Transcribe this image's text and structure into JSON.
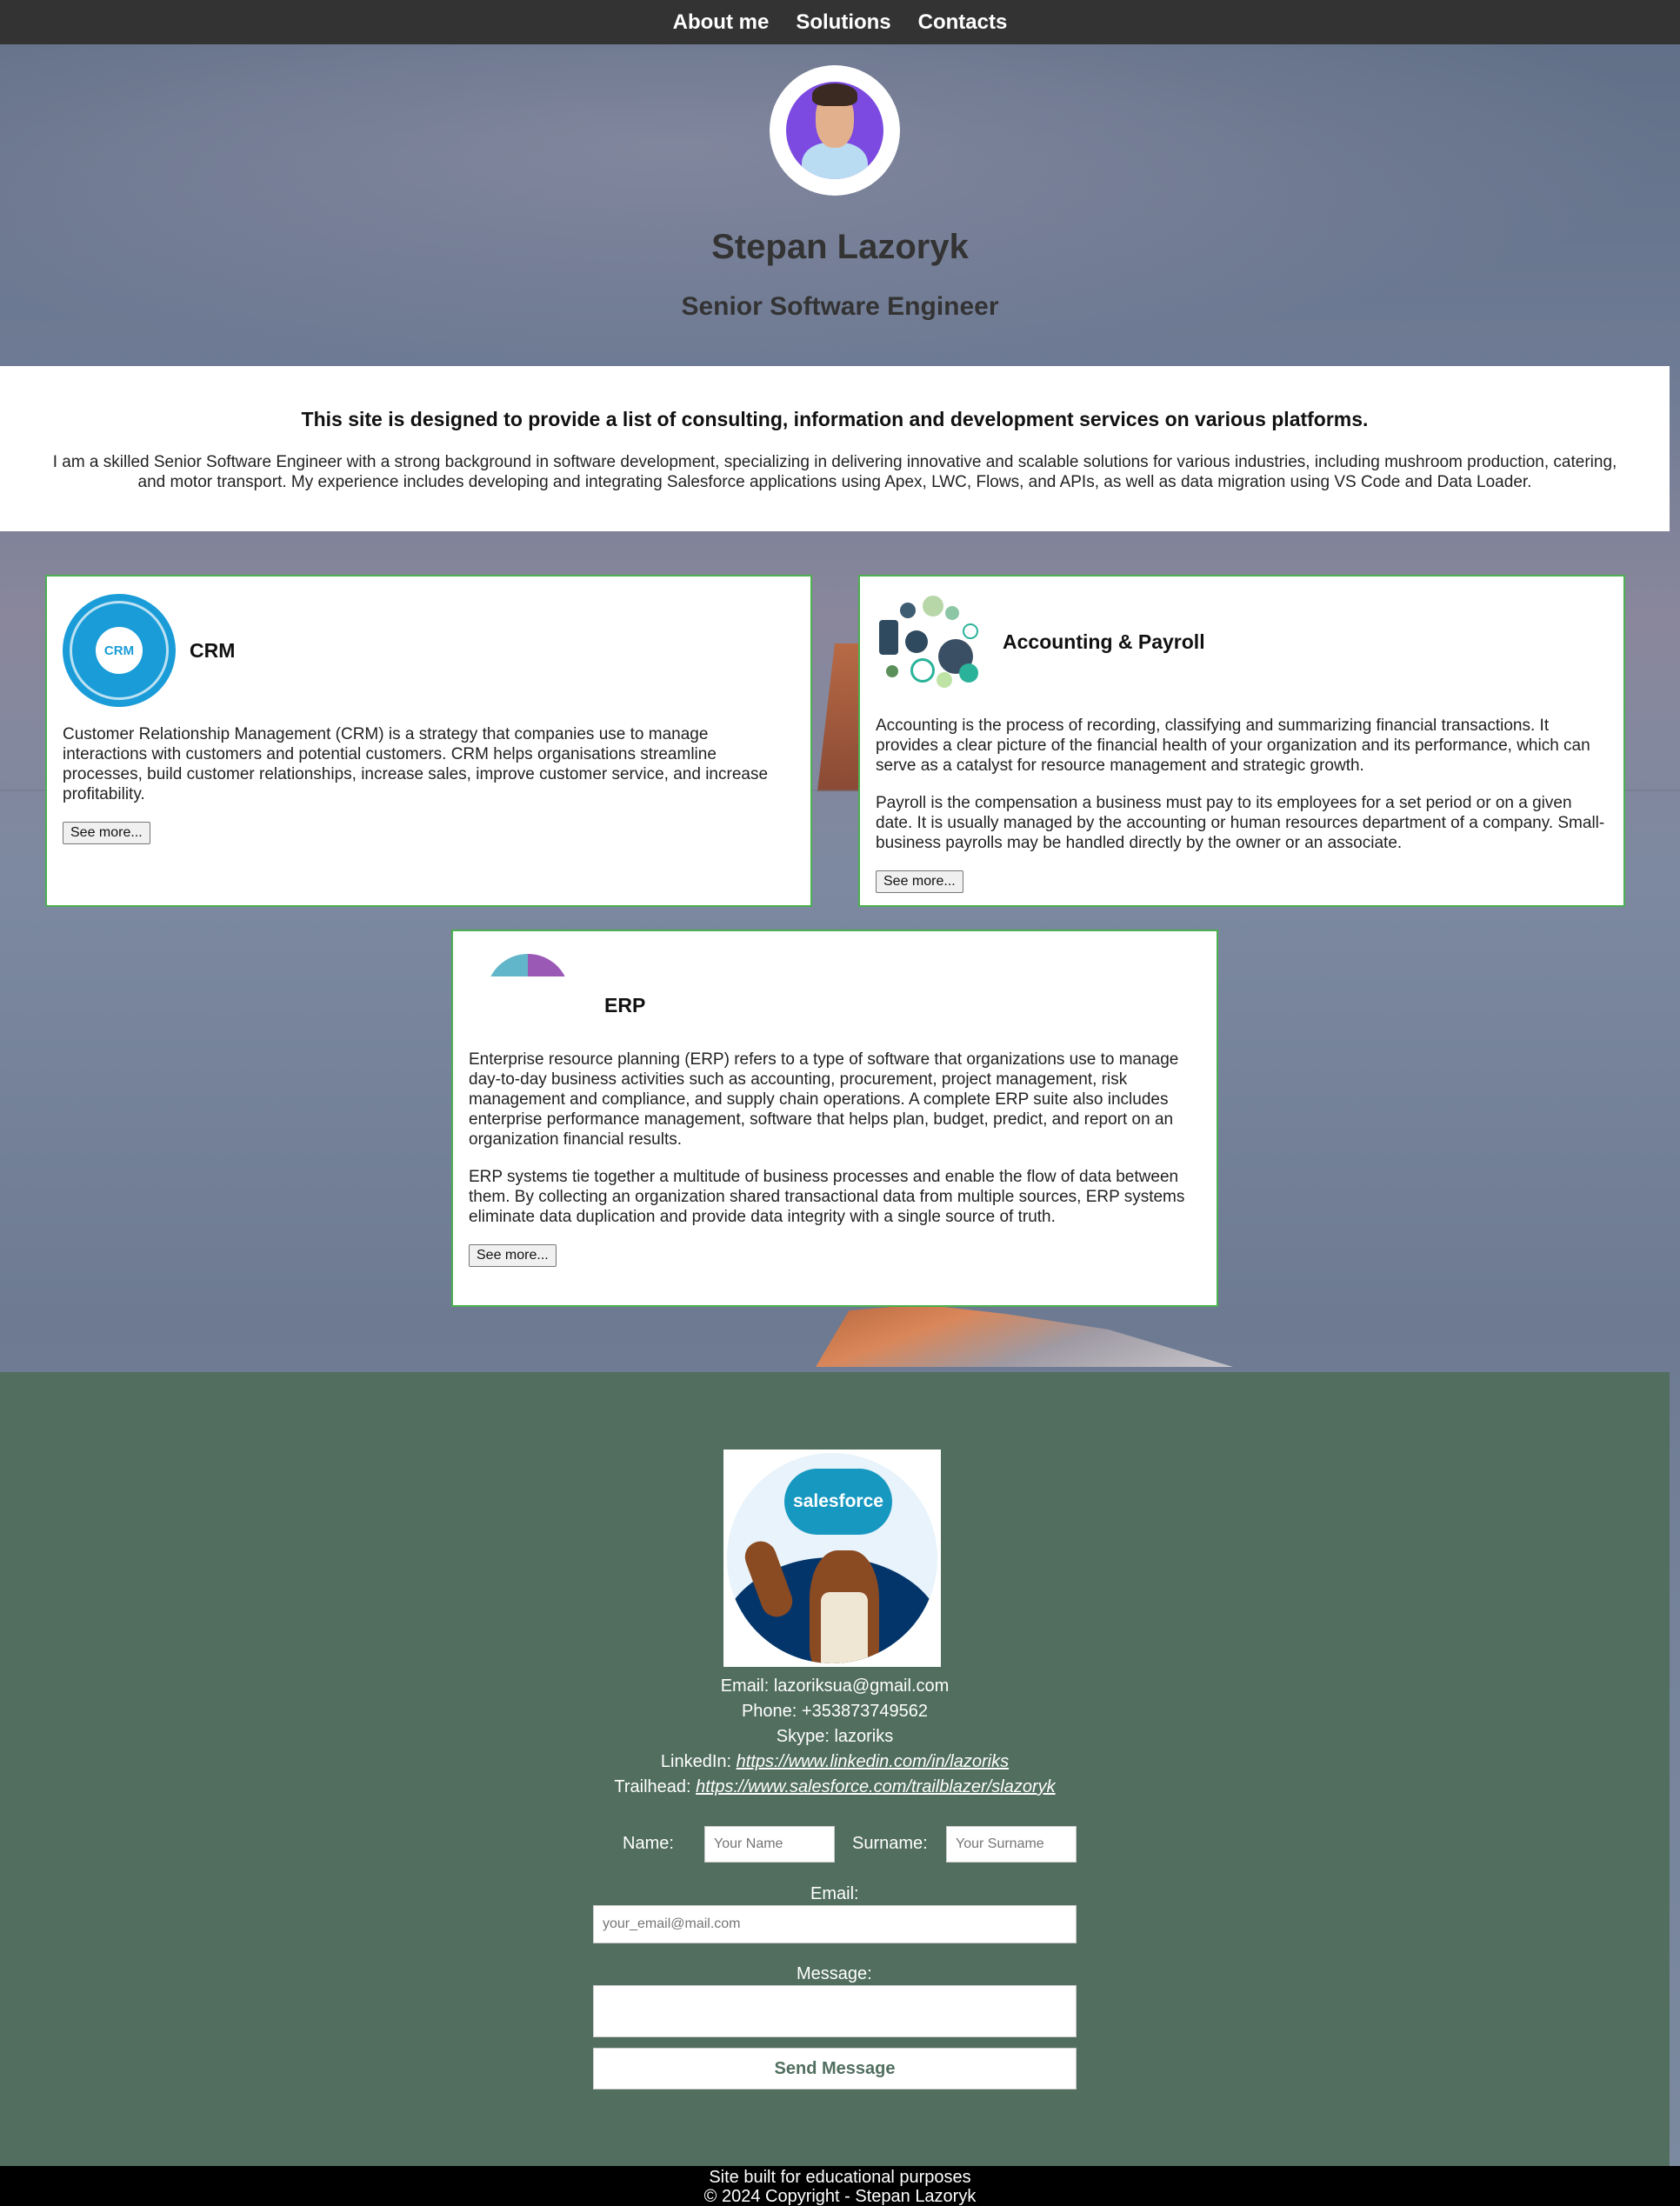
{
  "nav": {
    "items": [
      "About me",
      "Solutions",
      "Contacts"
    ]
  },
  "profile": {
    "name": "Stepan Lazoryk",
    "title": "Senior Software Engineer"
  },
  "intro": {
    "heading": "This site is designed to provide a list of consulting, information and development services on various platforms.",
    "text": "I am a skilled Senior Software Engineer with a strong background in software development, specializing in delivering innovative and scalable solutions for various industries, including mushroom production, catering, and motor transport. My experience includes developing and integrating Salesforce applications using Apex, LWC, Flows, and APIs, as well as data migration using VS Code and Data Loader."
  },
  "cards": [
    {
      "title": "CRM",
      "icon": "crm-icon",
      "icon_text": "CRM",
      "paragraphs": [
        "Customer Relationship Management (CRM) is a strategy that companies use to manage interactions with customers and potential customers. CRM helps organisations streamline processes, build customer relationships, increase sales, improve customer service, and increase profitability."
      ],
      "button": "See more..."
    },
    {
      "title": "Accounting & Payroll",
      "icon": "accounting-icon",
      "paragraphs": [
        "Accounting is the process of recording, classifying and summarizing financial transactions. It provides a clear picture of the financial health of your organization and its performance, which can serve as a catalyst for resource management and strategic growth.",
        "Payroll is the compensation a business must pay to its employees for a set period or on a given date. It is usually managed by the accounting or human resources department of a company. Small-business payrolls may be handled directly by the owner or an associate."
      ],
      "button": "See more..."
    },
    {
      "title": "ERP",
      "icon": "erp-icon",
      "paragraphs": [
        "Enterprise resource planning (ERP) refers to a type of software that organizations use to manage day-to-day business activities such as accounting, procurement, project management, risk management and compliance, and supply chain operations. A complete ERP suite also includes enterprise performance management, software that helps plan, budget, predict, and report on an organization financial results.",
        "ERP systems tie together a multitude of business processes and enable the flow of data between them. By collecting an organization shared transactional data from multiple sources, ERP systems eliminate data duplication and provide data integrity with a single source of truth."
      ],
      "button": "See more..."
    }
  ],
  "footer": {
    "logo_text": "salesforce",
    "email": {
      "label": "Email: ",
      "value": "lazoriksua@gmail.com"
    },
    "phone": {
      "label": "Phone: ",
      "value": "+353873749562"
    },
    "skype": {
      "label": "Skype: ",
      "value": "lazoriks"
    },
    "linkedin": {
      "label": "LinkedIn: ",
      "url": "https://www.linkedin.com/in/lazoriks"
    },
    "trailhead": {
      "label": "Trailhead: ",
      "url": "https://www.salesforce.com/trailblazer/slazoryk"
    },
    "form": {
      "name_label": "Name:",
      "name_placeholder": "Your Name",
      "surname_label": "Surname:",
      "surname_placeholder": "Your Surname",
      "email_label": "Email:",
      "email_placeholder": "your_email@mail.com",
      "message_label": "Message:",
      "send_label": "Send Message"
    }
  },
  "copyright": {
    "line1": "Site built for educational purposes",
    "line2": "© 2024 Copyright - Stepan Lazoryk"
  },
  "colors": {
    "nav_bg": "#333333",
    "footer_bg": "#516e5f",
    "card_border": "#4caf50",
    "copyright_bg": "#000000",
    "crm_blue": "#1a9cd8"
  }
}
